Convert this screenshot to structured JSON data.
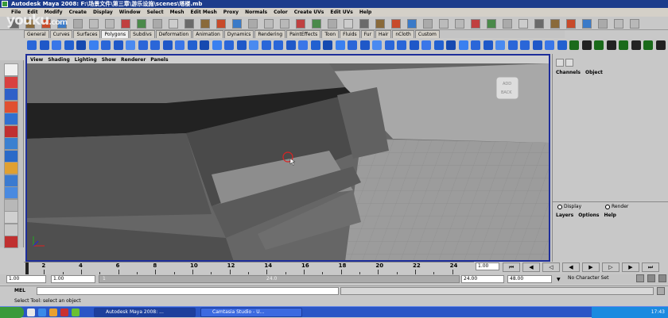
{
  "title": "Autodesk Maya 2008: F:\\场景文件\\第三章\\游乐设施\\scenes\\塔楼.mb",
  "watermark": "youku",
  "watermark_sub": ".com",
  "menus": [
    "File",
    "Edit",
    "Modify",
    "Create",
    "Display",
    "Window",
    "Select",
    "Mesh",
    "Edit Mesh",
    "Proxy",
    "Normals",
    "Color",
    "Create UVs",
    "Edit UVs",
    "Help"
  ],
  "shelf_tabs": [
    "General",
    "Curves",
    "Surfaces",
    "Polygons",
    "Subdivs",
    "Deformation",
    "Animation",
    "Dynamics",
    "Rendering",
    "PaintEffects",
    "Toon",
    "Fluids",
    "Fur",
    "Hair",
    "nCloth",
    "Custom"
  ],
  "active_shelf_tab": "Polygons",
  "panel_menus": [
    "View",
    "Shading",
    "Lighting",
    "Show",
    "Renderer",
    "Panels"
  ],
  "viewcube": {
    "top": "ADD",
    "front": "BACK"
  },
  "channel_box": {
    "menus": [
      "Channels",
      "Object"
    ]
  },
  "layer_editor": {
    "display_label": "Display",
    "render_label": "Render",
    "menus": [
      "Layers",
      "Options",
      "Help"
    ]
  },
  "timeline": {
    "ticks": [
      "2",
      "4",
      "6",
      "8",
      "10",
      "12",
      "14",
      "16",
      "18",
      "20",
      "22",
      "24"
    ],
    "current_frame": "1.00"
  },
  "range": {
    "start_time": "1.00",
    "playback_start": "1.00",
    "slider_start": "1",
    "slider_end": "24.0",
    "playback_end": "24.00",
    "end_time": "48.00",
    "character_set": "No Character Set"
  },
  "mel_label": "MEL",
  "help_line": "Select Tool: select an object",
  "taskbar": {
    "tasks": [
      {
        "label": "Autodesk Maya 2008: ...",
        "active": true
      },
      {
        "label": "Camtasia Studio - U...",
        "active": false
      }
    ],
    "clock": "17:43"
  }
}
